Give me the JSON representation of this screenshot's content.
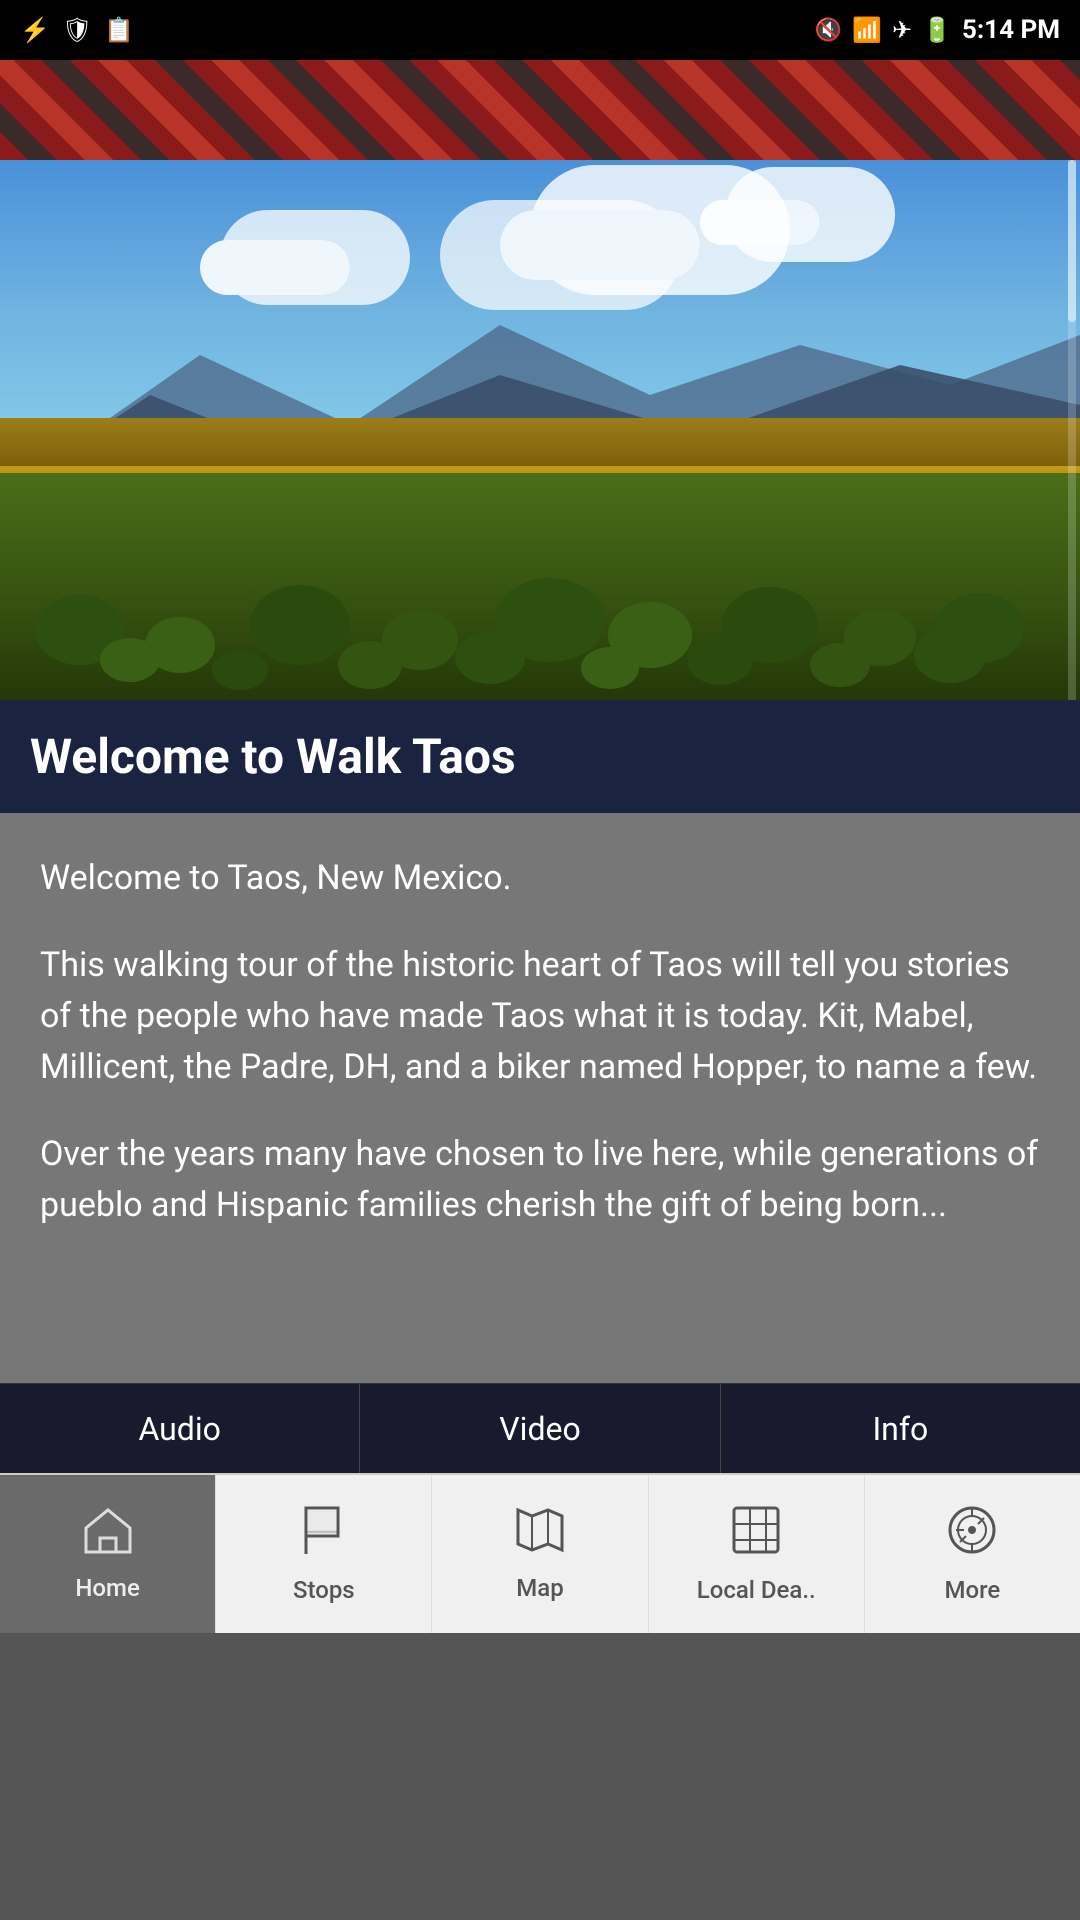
{
  "statusBar": {
    "time": "5:14 PM",
    "icons": {
      "left": [
        "usb-icon",
        "shield-icon",
        "clipboard-icon"
      ],
      "right": [
        "vibrate-icon",
        "wifi-icon",
        "airplane-icon",
        "battery-icon"
      ]
    }
  },
  "hero": {
    "title": "Welcome to Walk Taos"
  },
  "content": {
    "paragraph1": "Welcome to Taos, New Mexico.",
    "paragraph2": "This walking tour of the historic heart of Taos will tell you stories of the people who have made Taos what it is today. Kit, Mabel, Millicent, the Padre, DH, and a biker named Hopper, to name a few.",
    "paragraph3": "Over the years many have chosen to live here, while generations of pueblo and Hispanic families cherish the gift of being born..."
  },
  "mediaTabs": {
    "tabs": [
      {
        "id": "audio",
        "label": "Audio"
      },
      {
        "id": "video",
        "label": "Video"
      },
      {
        "id": "info",
        "label": "Info"
      }
    ]
  },
  "navBar": {
    "items": [
      {
        "id": "home",
        "label": "Home",
        "icon": "🏠",
        "active": true
      },
      {
        "id": "stops",
        "label": "Stops",
        "icon": "🚩",
        "active": false
      },
      {
        "id": "map",
        "label": "Map",
        "icon": "🗺",
        "active": false
      },
      {
        "id": "local-deals",
        "label": "Local Dea..",
        "icon": "⊞",
        "active": false
      },
      {
        "id": "more",
        "label": "More",
        "icon": "⊙",
        "active": false
      }
    ]
  }
}
